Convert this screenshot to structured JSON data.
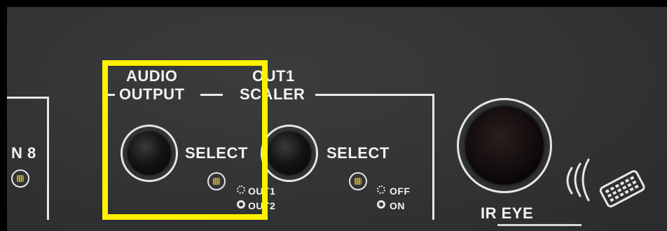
{
  "left_section": {
    "partial_label": "N 8"
  },
  "audio_output": {
    "label_line1": "AUDIO",
    "label_line2": "OUTPUT",
    "select_label": "SELECT"
  },
  "scaler": {
    "label_line1": "OUT1",
    "label_line2": "SCALER",
    "select_label": "SELECT"
  },
  "audio_legend": {
    "item1": "OUT1",
    "item2": "OUT2"
  },
  "scaler_legend": {
    "item1": "OFF",
    "item2": "ON"
  },
  "ir": {
    "label": "IR EYE"
  },
  "highlight_color": "#fff200"
}
